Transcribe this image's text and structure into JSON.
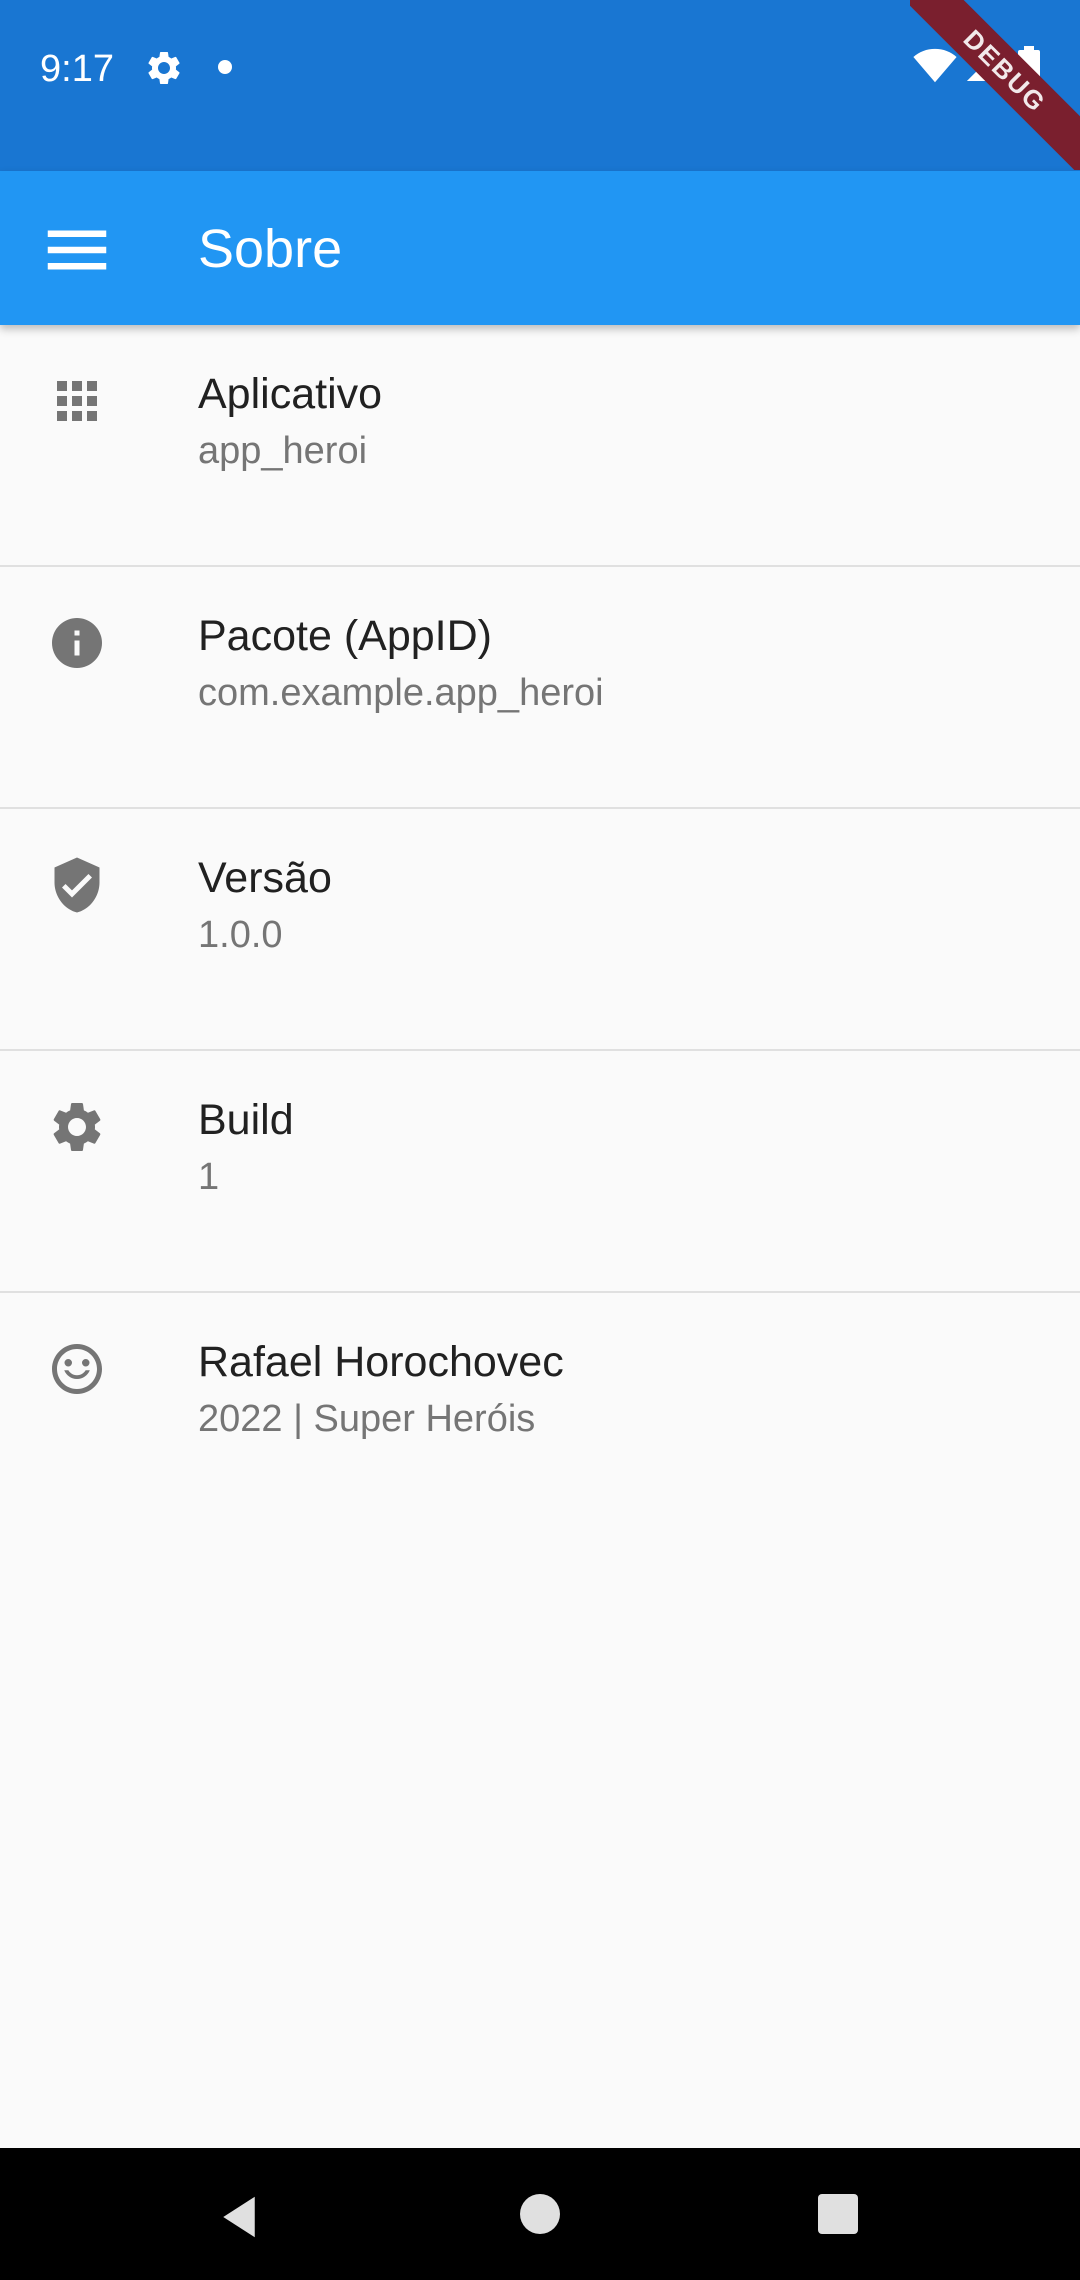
{
  "status_bar": {
    "time": "9:17",
    "icons": [
      "gear-icon",
      "dot-icon",
      "wifi-icon",
      "signal-icon",
      "battery-icon"
    ]
  },
  "debug_banner": "DEBUG",
  "app_bar": {
    "title": "Sobre",
    "menu_icon": "menu-icon",
    "color": "#2196f3"
  },
  "items": [
    {
      "icon": "apps-grid-icon",
      "title": "Aplicativo",
      "subtitle": "app_heroi"
    },
    {
      "icon": "info-icon",
      "title": "Pacote (AppID)",
      "subtitle": "com.example.app_heroi"
    },
    {
      "icon": "verified-shield-icon",
      "title": "Versão",
      "subtitle": "1.0.0"
    },
    {
      "icon": "settings-gear-icon",
      "title": "Build",
      "subtitle": "1"
    },
    {
      "icon": "smiley-face-icon",
      "title": "Rafael Horochovec",
      "subtitle": "2022 | Super Heróis"
    }
  ],
  "nav_bar": {
    "icons": [
      "back-icon",
      "home-icon",
      "recents-icon"
    ]
  }
}
